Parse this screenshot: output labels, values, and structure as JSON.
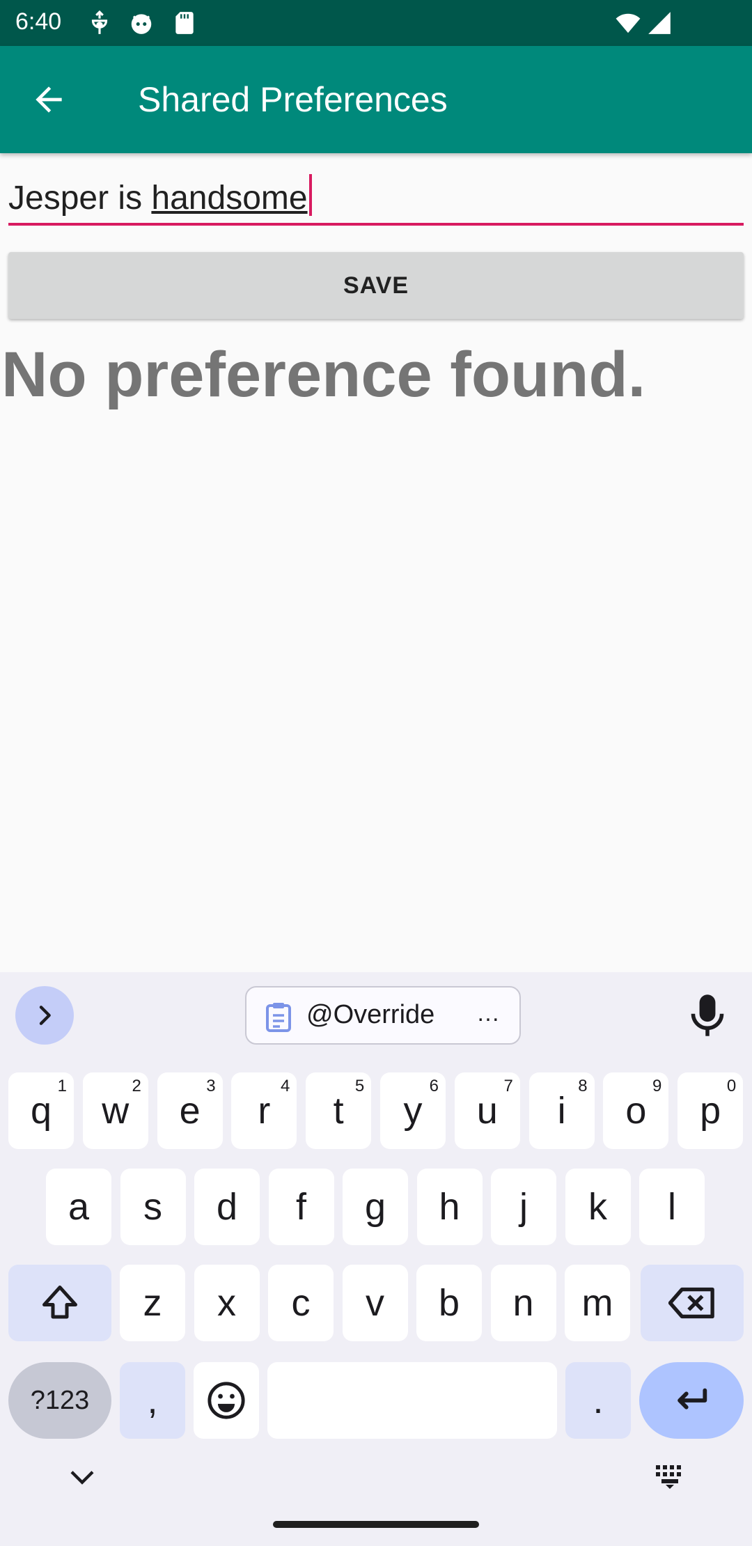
{
  "status_bar": {
    "time": "6:40",
    "icons": [
      "usb-debug-icon",
      "android-head-icon",
      "sd-card-icon",
      "wifi-icon",
      "signal-icon"
    ],
    "bg_color": "#00574b"
  },
  "app_bar": {
    "title": "Shared Preferences",
    "back_icon": "arrow-back-icon",
    "bg_color": "#00897b"
  },
  "input": {
    "value_plain": "Jesper is ",
    "value_underlined": "handsome",
    "accent_color": "#d81b60"
  },
  "save_button": {
    "label": "SAVE"
  },
  "result": {
    "text": "No preference found."
  },
  "keyboard": {
    "clipboard_suggestion": "@Override",
    "clipboard_ellipsis": "…",
    "row1": [
      {
        "key": "q",
        "hint": "1"
      },
      {
        "key": "w",
        "hint": "2"
      },
      {
        "key": "e",
        "hint": "3"
      },
      {
        "key": "r",
        "hint": "4"
      },
      {
        "key": "t",
        "hint": "5"
      },
      {
        "key": "y",
        "hint": "6"
      },
      {
        "key": "u",
        "hint": "7"
      },
      {
        "key": "i",
        "hint": "8"
      },
      {
        "key": "o",
        "hint": "9"
      },
      {
        "key": "p",
        "hint": "0"
      }
    ],
    "row2": [
      "a",
      "s",
      "d",
      "f",
      "g",
      "h",
      "j",
      "k",
      "l"
    ],
    "row3": [
      "z",
      "x",
      "c",
      "v",
      "b",
      "n",
      "m"
    ],
    "symbols_label": "?123",
    "comma_label": ",",
    "period_label": ".",
    "enter_color": "#aec4ff",
    "modifier_color": "#dde2f9"
  }
}
